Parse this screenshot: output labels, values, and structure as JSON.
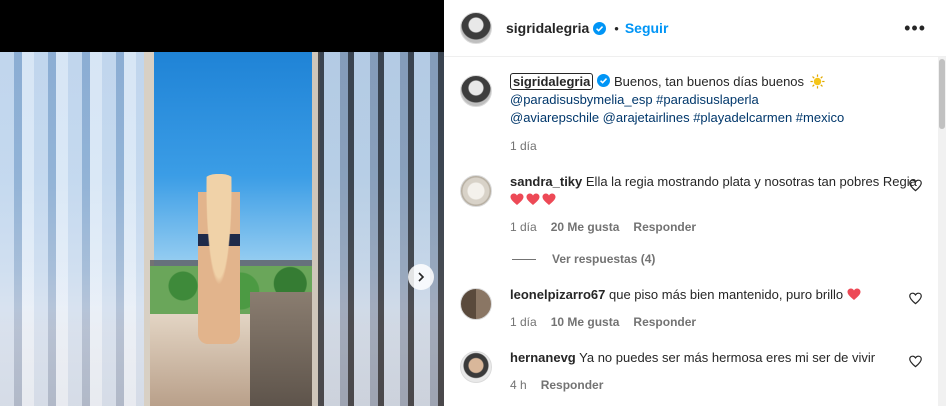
{
  "post": {
    "author": "sigridalegria",
    "follow_label": "Seguir",
    "more_label": "•••",
    "caption_text": "Buenos, tan buenos días buenos",
    "caption_tags_1": "@paradisusbymelia_esp #paradisuslaperla",
    "caption_tags_2": "@aviarepschile @arajetairlines #playadelcarmen #mexico",
    "time": "1 día"
  },
  "comments": [
    {
      "user": "sandra_tiky",
      "text": "Ella la regia mostrando plata y nosotras tan pobres Regia",
      "time": "1 día",
      "likes": "20 Me gusta",
      "reply": "Responder",
      "view_replies": "Ver respuestas (4)"
    },
    {
      "user": "leonelpizarro67",
      "text": "que piso más bien mantenido, puro brillo",
      "time": "1 día",
      "likes": "10 Me gusta",
      "reply": "Responder"
    },
    {
      "user": "hernanevg",
      "text": "Ya no puedes ser más hermosa eres mi ser de vivir",
      "time": "4 h",
      "reply": "Responder"
    }
  ],
  "colors": {
    "link": "#00376b",
    "accent": "#0095f6",
    "heart": "#ed4956"
  }
}
